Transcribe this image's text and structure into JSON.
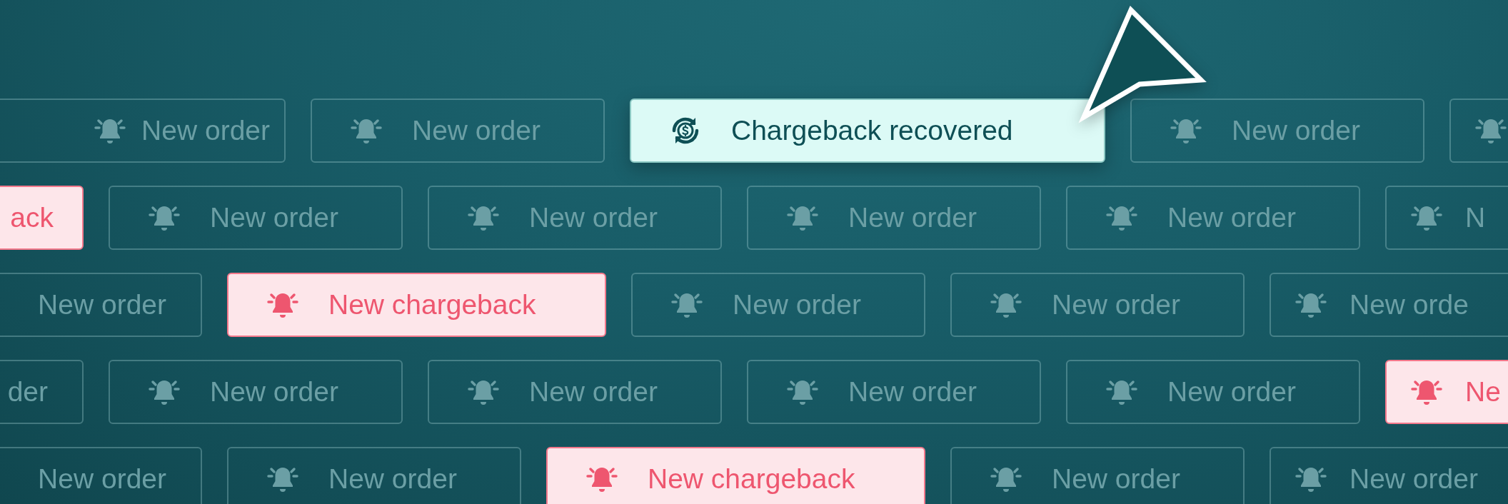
{
  "rows": [
    {
      "chips": [
        {
          "kind": "order",
          "label": "New order",
          "icon_shown": true
        },
        {
          "kind": "order",
          "label": "New order",
          "icon_shown": true
        },
        {
          "kind": "recovered",
          "label": "Chargeback recovered",
          "icon_shown": true
        },
        {
          "kind": "order",
          "label": "New order",
          "icon_shown": true
        },
        {
          "kind": "order",
          "icon_shown": true
        }
      ]
    },
    {
      "chips": [
        {
          "kind": "chargeback",
          "label": "ack",
          "icon_shown": false
        },
        {
          "kind": "order",
          "label": "New order",
          "icon_shown": true
        },
        {
          "kind": "order",
          "label": "New order",
          "icon_shown": true
        },
        {
          "kind": "order",
          "label": "New order",
          "icon_shown": true
        },
        {
          "kind": "order",
          "label": "New order",
          "icon_shown": true
        },
        {
          "kind": "order",
          "label": "N",
          "icon_shown": true
        }
      ]
    },
    {
      "chips": [
        {
          "kind": "order",
          "label": "New order",
          "icon_shown": false
        },
        {
          "kind": "chargeback",
          "label": "New chargeback",
          "icon_shown": true
        },
        {
          "kind": "order",
          "label": "New order",
          "icon_shown": true
        },
        {
          "kind": "order",
          "label": "New order",
          "icon_shown": true
        },
        {
          "kind": "order",
          "label": "New orde",
          "icon_shown": true
        }
      ]
    },
    {
      "chips": [
        {
          "kind": "order",
          "label": "der",
          "icon_shown": false
        },
        {
          "kind": "order",
          "label": "New order",
          "icon_shown": true
        },
        {
          "kind": "order",
          "label": "New order",
          "icon_shown": true
        },
        {
          "kind": "order",
          "label": "New order",
          "icon_shown": true
        },
        {
          "kind": "order",
          "label": "New order",
          "icon_shown": true
        },
        {
          "kind": "chargeback",
          "label": "Ne",
          "icon_shown": true
        }
      ]
    },
    {
      "chips": [
        {
          "kind": "order",
          "label": "New order",
          "icon_shown": false
        },
        {
          "kind": "order",
          "label": "New order",
          "icon_shown": true
        },
        {
          "kind": "chargeback",
          "label": "New chargeback",
          "icon_shown": true
        },
        {
          "kind": "order",
          "label": "New order",
          "icon_shown": true
        },
        {
          "kind": "order",
          "label": "New order",
          "icon_shown": true
        }
      ]
    }
  ]
}
